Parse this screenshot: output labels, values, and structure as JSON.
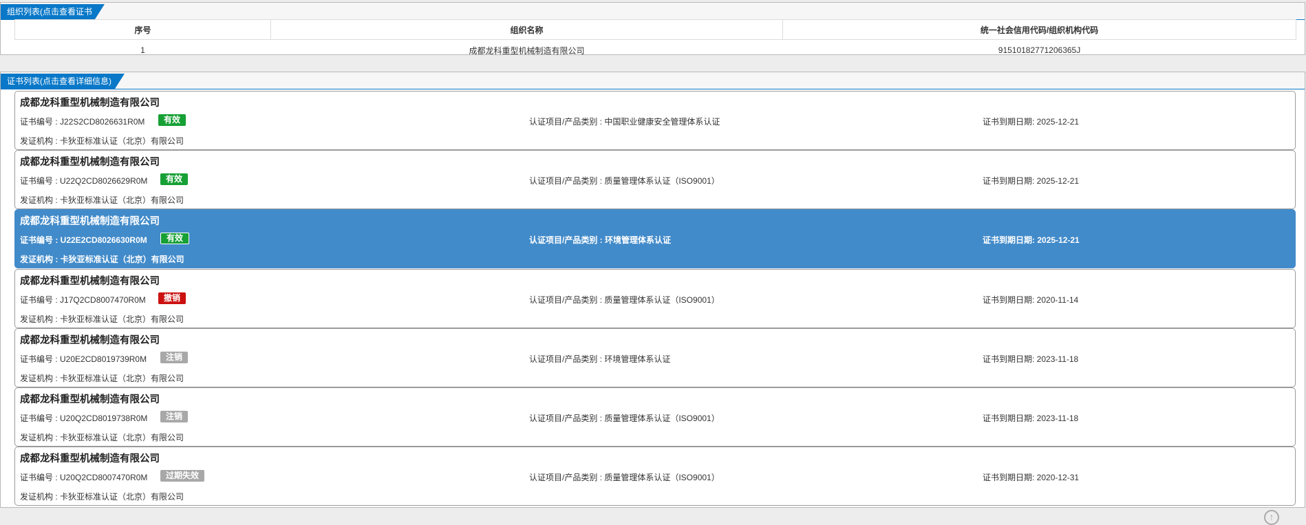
{
  "org_panel": {
    "title": "组织列表(点击查看证书信息)",
    "columns": [
      "序号",
      "组织名称",
      "统一社会信用代码/组织机构代码"
    ],
    "rows": [
      {
        "index": "1",
        "name": "成都龙科重型机械制造有限公司",
        "code": "91510182771206365J"
      }
    ]
  },
  "cert_panel": {
    "title": "证书列表(点击查看详细信息)",
    "labels": {
      "cert_no": "证书编号 : ",
      "item": "认证项目/产品类别 : ",
      "expiry": "证书到期日期: ",
      "issuer": "发证机构 : "
    },
    "items": [
      {
        "company": "成都龙科重型机械制造有限公司",
        "cert_no": "J22S2CD8026631R0M",
        "status": "有效",
        "status_color": "#17a035",
        "item": "中国职业健康安全管理体系认证",
        "expiry": "2025-12-21",
        "issuer": "卡狄亚标准认证（北京）有限公司"
      },
      {
        "company": "成都龙科重型机械制造有限公司",
        "cert_no": "U22Q2CD8026629R0M",
        "status": "有效",
        "status_color": "#17a035",
        "item": "质量管理体系认证（ISO9001）",
        "expiry": "2025-12-21",
        "issuer": "卡狄亚标准认证（北京）有限公司"
      },
      {
        "company": "成都龙科重型机械制造有限公司",
        "cert_no": "U22E2CD8026630R0M",
        "status": "有效",
        "status_color": "#17a035",
        "item": "环境管理体系认证",
        "expiry": "2025-12-21",
        "issuer": "卡狄亚标准认证（北京）有限公司"
      },
      {
        "company": "成都龙科重型机械制造有限公司",
        "cert_no": "J17Q2CD8007470R0M",
        "status": "撤销",
        "status_color": "#cc1111",
        "item": "质量管理体系认证（ISO9001）",
        "expiry": "2020-11-14",
        "issuer": "卡狄亚标准认证（北京）有限公司"
      },
      {
        "company": "成都龙科重型机械制造有限公司",
        "cert_no": "U20E2CD8019739R0M",
        "status": "注销",
        "status_color": "#a8a8a8",
        "item": "环境管理体系认证",
        "expiry": "2023-11-18",
        "issuer": "卡狄亚标准认证（北京）有限公司"
      },
      {
        "company": "成都龙科重型机械制造有限公司",
        "cert_no": "U20Q2CD8019738R0M",
        "status": "注销",
        "status_color": "#a8a8a8",
        "item": "质量管理体系认证（ISO9001）",
        "expiry": "2023-11-18",
        "issuer": "卡狄亚标准认证（北京）有限公司"
      },
      {
        "company": "成都龙科重型机械制造有限公司",
        "cert_no": "U20Q2CD8007470R0M",
        "status": "过期失效",
        "status_color": "#a8a8a8",
        "item": "质量管理体系认证（ISO9001）",
        "expiry": "2020-12-31",
        "issuer": "卡狄亚标准认证（北京）有限公司"
      }
    ],
    "selected_index": 2
  },
  "scroll_top_icon": "arrow-up-circle-icon",
  "colors": {
    "accent": "#0a78c8",
    "selected": "#428bca"
  }
}
